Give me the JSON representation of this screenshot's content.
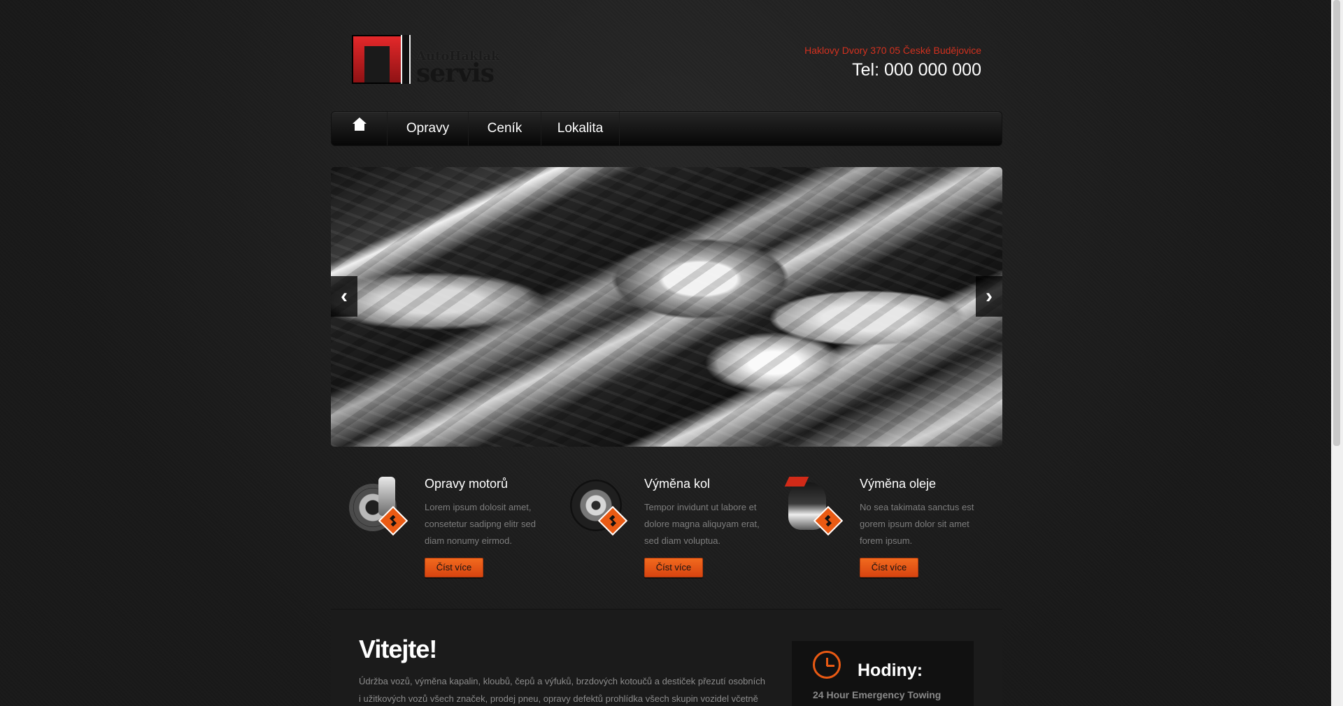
{
  "header": {
    "logo_line1": "AutoHaklak",
    "logo_line2": "servis",
    "address": "Haklovy Dvory 370 05 České Budějovice",
    "phone": "Tel: 000 000 000"
  },
  "nav": {
    "items": [
      {
        "label": "Opravy"
      },
      {
        "label": "Ceník"
      },
      {
        "label": "Lokalita"
      }
    ]
  },
  "slider": {
    "prev_symbol": "‹",
    "next_symbol": "›"
  },
  "features": [
    {
      "title": "Opravy motorů",
      "text": "Lorem ipsum dolosit amet, consetetur sadipng elitr sed diam nonumy eirmod.",
      "button": "Číst více"
    },
    {
      "title": "Výměna kol",
      "text": "Tempor invidunt ut labore et dolore magna aliquyam erat, sed diam voluptua.",
      "button": "Číst více"
    },
    {
      "title": "Výměna oleje",
      "text": "No sea takimata sanctus est gorem ipsum dolor sit amet forem ipsum.",
      "button": "Číst více"
    }
  ],
  "content": {
    "welcome_title": "Vitejte!",
    "welcome_text": "Údržba vozů, výměna kapalin, kloubů, čepů a výfuků, brzdových kotoučů a destiček přezutí osobních i užitkových vozů všech značek, prodej pneu, opravy defektů prohlídka všech skupin vozidel včetně",
    "hours_title": "Hodiny:",
    "hours_subtitle": "24 Hour Emergency Towing"
  },
  "colors": {
    "accent": "#ea5a13",
    "address": "#d2311f"
  },
  "icons": {
    "home": "home-icon",
    "engine": "engine-repair-icon",
    "wheel": "wheel-icon",
    "oil": "oil-can-icon",
    "clock": "clock-icon"
  }
}
